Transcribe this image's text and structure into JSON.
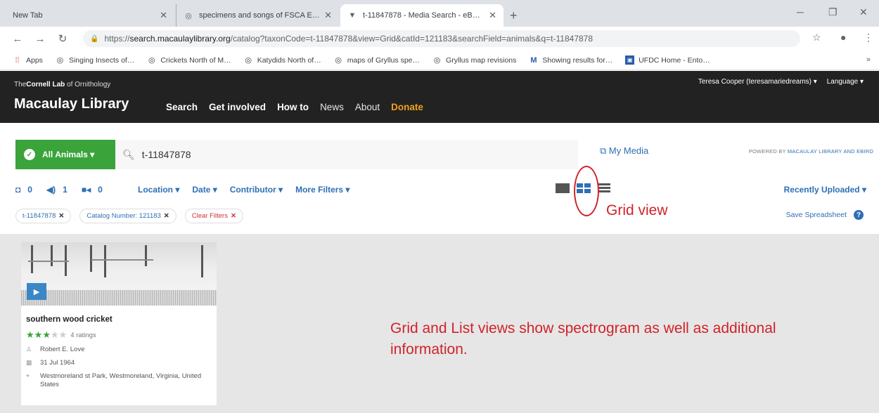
{
  "browser": {
    "tabs": [
      {
        "label": "New Tab"
      },
      {
        "label": "specimens and songs of FSCA E…"
      },
      {
        "label": "t-11847878 - Media Search - eB…"
      }
    ],
    "url_prefix": "https://",
    "url_host": "search.macaulaylibrary.org",
    "url_path": "/catalog?taxonCode=t-11847878&view=Grid&catId=121183&searchField=animals&q=t-11847878",
    "bookmarks": [
      {
        "label": "Apps",
        "icon": "apps-grid-icon"
      },
      {
        "label": "Singing Insects of…",
        "icon": "globe-icon"
      },
      {
        "label": "Crickets North of M…",
        "icon": "globe-icon"
      },
      {
        "label": "Katydids North of…",
        "icon": "globe-icon"
      },
      {
        "label": "maps of Gryllus spe…",
        "icon": "globe-icon"
      },
      {
        "label": "Gryllus map revisions",
        "icon": "globe-icon"
      },
      {
        "label": "Showing results for…",
        "icon": "mw-logo-icon"
      },
      {
        "label": "UFDC Home - Ento…",
        "icon": "ufdc-icon"
      }
    ]
  },
  "site": {
    "lab_prefix": "The",
    "lab_name": "Cornell Lab",
    "lab_suffix": "of Ornithology",
    "brand": "Macaulay Library",
    "nav": {
      "search": "Search",
      "get_involved": "Get involved",
      "how_to": "How to",
      "news": "News",
      "about": "About",
      "donate": "Donate"
    },
    "user": "Teresa Cooper (teresamariedreams) ▾",
    "language": "Language ▾"
  },
  "search": {
    "taxon_button": "All Animals ▾",
    "query": "t-11847878",
    "my_media": "My Media",
    "powered_prefix": "POWERED BY ",
    "powered_links": "MACAULAY LIBRARY AND EBIRD",
    "counts": {
      "photos": "0",
      "audio": "1",
      "video": "0"
    },
    "filters": [
      "Location ▾",
      "Date ▾",
      "Contributor ▾",
      "More Filters ▾"
    ],
    "sort": "Recently Uploaded ▾",
    "chips": [
      {
        "label": "t-11847878"
      },
      {
        "label": "Catalog Number: 121183"
      }
    ],
    "clear_filters": "Clear Filters",
    "save_spreadsheet": "Save Spreadsheet"
  },
  "result": {
    "title": "southern wood cricket",
    "rating_stars": 3,
    "rating_count": "4 ratings",
    "recordist": "Robert E. Love",
    "date": "31 Jul 1964",
    "location": "Westmoreland st Park, Westmoreland, Virginia, United States"
  },
  "annotations": {
    "grid_view": "Grid view",
    "note": "Grid and List views show spectrogram as well as additional information."
  },
  "colors": {
    "accent": "#2e6fb5",
    "green": "#3aa33a",
    "annotation": "#d0232a",
    "donate": "#f0a01e"
  }
}
